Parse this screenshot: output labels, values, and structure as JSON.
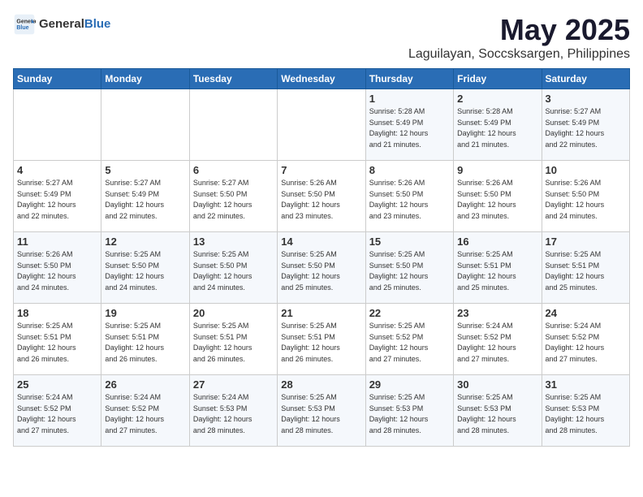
{
  "header": {
    "logo_general": "General",
    "logo_blue": "Blue",
    "month_title": "May 2025",
    "location": "Laguilayan, Soccsksargen, Philippines"
  },
  "days_of_week": [
    "Sunday",
    "Monday",
    "Tuesday",
    "Wednesday",
    "Thursday",
    "Friday",
    "Saturday"
  ],
  "weeks": [
    [
      {
        "day": "",
        "info": ""
      },
      {
        "day": "",
        "info": ""
      },
      {
        "day": "",
        "info": ""
      },
      {
        "day": "",
        "info": ""
      },
      {
        "day": "1",
        "info": "Sunrise: 5:28 AM\nSunset: 5:49 PM\nDaylight: 12 hours\nand 21 minutes."
      },
      {
        "day": "2",
        "info": "Sunrise: 5:28 AM\nSunset: 5:49 PM\nDaylight: 12 hours\nand 21 minutes."
      },
      {
        "day": "3",
        "info": "Sunrise: 5:27 AM\nSunset: 5:49 PM\nDaylight: 12 hours\nand 22 minutes."
      }
    ],
    [
      {
        "day": "4",
        "info": "Sunrise: 5:27 AM\nSunset: 5:49 PM\nDaylight: 12 hours\nand 22 minutes."
      },
      {
        "day": "5",
        "info": "Sunrise: 5:27 AM\nSunset: 5:49 PM\nDaylight: 12 hours\nand 22 minutes."
      },
      {
        "day": "6",
        "info": "Sunrise: 5:27 AM\nSunset: 5:50 PM\nDaylight: 12 hours\nand 22 minutes."
      },
      {
        "day": "7",
        "info": "Sunrise: 5:26 AM\nSunset: 5:50 PM\nDaylight: 12 hours\nand 23 minutes."
      },
      {
        "day": "8",
        "info": "Sunrise: 5:26 AM\nSunset: 5:50 PM\nDaylight: 12 hours\nand 23 minutes."
      },
      {
        "day": "9",
        "info": "Sunrise: 5:26 AM\nSunset: 5:50 PM\nDaylight: 12 hours\nand 23 minutes."
      },
      {
        "day": "10",
        "info": "Sunrise: 5:26 AM\nSunset: 5:50 PM\nDaylight: 12 hours\nand 24 minutes."
      }
    ],
    [
      {
        "day": "11",
        "info": "Sunrise: 5:26 AM\nSunset: 5:50 PM\nDaylight: 12 hours\nand 24 minutes."
      },
      {
        "day": "12",
        "info": "Sunrise: 5:25 AM\nSunset: 5:50 PM\nDaylight: 12 hours\nand 24 minutes."
      },
      {
        "day": "13",
        "info": "Sunrise: 5:25 AM\nSunset: 5:50 PM\nDaylight: 12 hours\nand 24 minutes."
      },
      {
        "day": "14",
        "info": "Sunrise: 5:25 AM\nSunset: 5:50 PM\nDaylight: 12 hours\nand 25 minutes."
      },
      {
        "day": "15",
        "info": "Sunrise: 5:25 AM\nSunset: 5:50 PM\nDaylight: 12 hours\nand 25 minutes."
      },
      {
        "day": "16",
        "info": "Sunrise: 5:25 AM\nSunset: 5:51 PM\nDaylight: 12 hours\nand 25 minutes."
      },
      {
        "day": "17",
        "info": "Sunrise: 5:25 AM\nSunset: 5:51 PM\nDaylight: 12 hours\nand 25 minutes."
      }
    ],
    [
      {
        "day": "18",
        "info": "Sunrise: 5:25 AM\nSunset: 5:51 PM\nDaylight: 12 hours\nand 26 minutes."
      },
      {
        "day": "19",
        "info": "Sunrise: 5:25 AM\nSunset: 5:51 PM\nDaylight: 12 hours\nand 26 minutes."
      },
      {
        "day": "20",
        "info": "Sunrise: 5:25 AM\nSunset: 5:51 PM\nDaylight: 12 hours\nand 26 minutes."
      },
      {
        "day": "21",
        "info": "Sunrise: 5:25 AM\nSunset: 5:51 PM\nDaylight: 12 hours\nand 26 minutes."
      },
      {
        "day": "22",
        "info": "Sunrise: 5:25 AM\nSunset: 5:52 PM\nDaylight: 12 hours\nand 27 minutes."
      },
      {
        "day": "23",
        "info": "Sunrise: 5:24 AM\nSunset: 5:52 PM\nDaylight: 12 hours\nand 27 minutes."
      },
      {
        "day": "24",
        "info": "Sunrise: 5:24 AM\nSunset: 5:52 PM\nDaylight: 12 hours\nand 27 minutes."
      }
    ],
    [
      {
        "day": "25",
        "info": "Sunrise: 5:24 AM\nSunset: 5:52 PM\nDaylight: 12 hours\nand 27 minutes."
      },
      {
        "day": "26",
        "info": "Sunrise: 5:24 AM\nSunset: 5:52 PM\nDaylight: 12 hours\nand 27 minutes."
      },
      {
        "day": "27",
        "info": "Sunrise: 5:24 AM\nSunset: 5:53 PM\nDaylight: 12 hours\nand 28 minutes."
      },
      {
        "day": "28",
        "info": "Sunrise: 5:25 AM\nSunset: 5:53 PM\nDaylight: 12 hours\nand 28 minutes."
      },
      {
        "day": "29",
        "info": "Sunrise: 5:25 AM\nSunset: 5:53 PM\nDaylight: 12 hours\nand 28 minutes."
      },
      {
        "day": "30",
        "info": "Sunrise: 5:25 AM\nSunset: 5:53 PM\nDaylight: 12 hours\nand 28 minutes."
      },
      {
        "day": "31",
        "info": "Sunrise: 5:25 AM\nSunset: 5:53 PM\nDaylight: 12 hours\nand 28 minutes."
      }
    ]
  ]
}
